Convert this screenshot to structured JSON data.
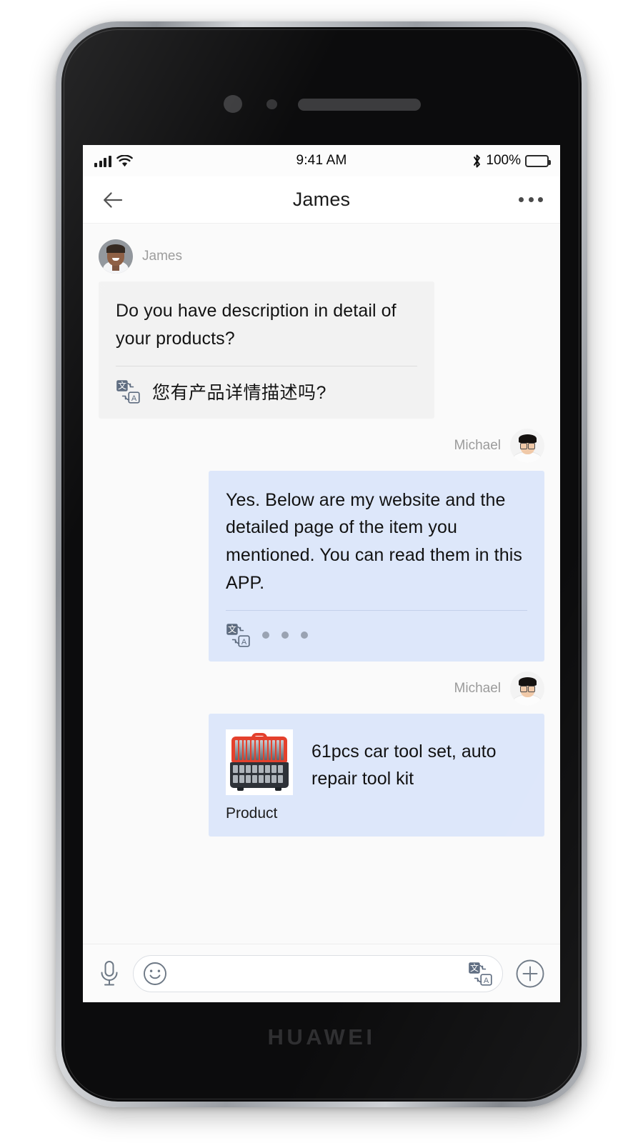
{
  "device": {
    "brand": "HUAWEI"
  },
  "status_bar": {
    "time": "9:41 AM",
    "battery_percent": "100%",
    "signal_icon": "cellular-signal-icon",
    "wifi_icon": "wifi-icon",
    "bluetooth_icon": "bluetooth-icon",
    "battery_icon": "battery-full-icon"
  },
  "header": {
    "back_icon": "back-arrow-icon",
    "title": "James",
    "more_icon": "more-options-icon"
  },
  "messages": [
    {
      "sender": "James",
      "direction": "in",
      "text": "Do you have description in detail of  your products?",
      "translate_icon": "translate-icon",
      "translation": "您有产品详情描述吗?"
    },
    {
      "sender": "Michael",
      "direction": "out",
      "text": "Yes. Below are my website and the detailed page of the item you mentioned. You can read them in this APP.",
      "translate_icon": "translate-icon",
      "translation_loading": "• • •"
    },
    {
      "sender": "Michael",
      "direction": "out",
      "type": "product-card",
      "product_label": "Product",
      "product_title": "61pcs car tool set, auto repair tool kit",
      "product_image": "red-tool-case-image"
    }
  ],
  "input_bar": {
    "mic_icon": "microphone-icon",
    "emoji_icon": "smiley-face-icon",
    "translate_icon": "translate-icon",
    "plus_icon": "plus-circle-icon",
    "placeholder": ""
  },
  "colors": {
    "incoming_bubble": "#f2f2f2",
    "outgoing_bubble": "#dde7fa",
    "chat_background": "#fafafa",
    "text_primary": "#121212",
    "text_muted": "#9b9b9b"
  }
}
